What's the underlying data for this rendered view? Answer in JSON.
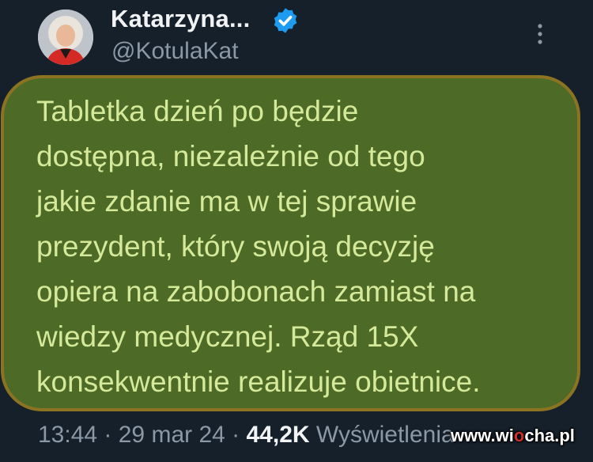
{
  "author": {
    "display_name": "Katarzyna...",
    "handle": "@KotulaKat",
    "verified": true,
    "verified_color": "#1d9bf0"
  },
  "header": {
    "more_icon": "more-vertical-icon"
  },
  "tweet": {
    "text": "Tabletka dzień po będzie\ndostępna, niezależnie od tego\njakie zdanie ma w tej sprawie\nprezydent, który swoją decyzję\nopiera na zabobonach zamiast na\nwiedzy medycznej. Rząd 15X\nkonsekwentnie realizuje obietnice.",
    "highlight_bg": "#4d6b27",
    "highlight_border": "#8c7322",
    "text_color": "#d5e99a"
  },
  "meta": {
    "time": "13:44",
    "separator": " · ",
    "date": "29 mar 24",
    "views_count": "44,2K",
    "views_label": "Wyświetlenia"
  },
  "watermark": {
    "prefix": "www.",
    "brand_start": "wi",
    "dot": "o",
    "brand_end": "cha.pl"
  }
}
